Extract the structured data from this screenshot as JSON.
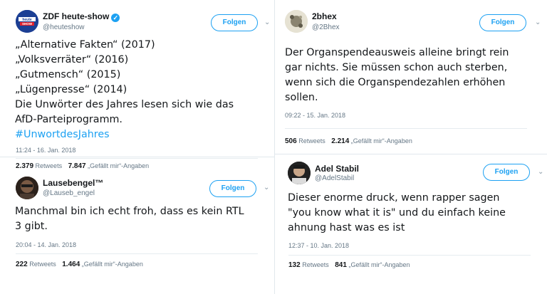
{
  "tweets": [
    {
      "name": "ZDF heute-show",
      "handle": "@heuteshow",
      "verified": true,
      "follow_label": "Folgen",
      "lines": [
        "„Alternative Fakten“ (2017)",
        "„Volksverräter“ (2016)",
        "„Gutmensch“ (2015)",
        "„Lügenpresse“ (2014)",
        "Die Unwörter des Jahres lesen sich wie das",
        "AfD-Parteiprogramm."
      ],
      "hashtag": "#UnwortdesJahres",
      "time": "11:24 - 16. Jan. 2018",
      "retweets": "2.379",
      "retweets_label": "Retweets",
      "likes": "7.847",
      "likes_label": "„Gefällt mir“-Angaben",
      "avatar_text": "heute SHOW"
    },
    {
      "name": "2bhex",
      "handle": "@2Bhex",
      "follow_label": "Folgen",
      "lines": [
        "Der Organspendeausweis alleine bringt rein",
        "gar nichts. Sie müssen schon auch sterben,",
        "wenn sich die Organspendezahlen erhöhen",
        "sollen."
      ],
      "time": "09:22 - 15. Jan. 2018",
      "retweets": "506",
      "retweets_label": "Retweets",
      "likes": "2.214",
      "likes_label": "„Gefällt mir“-Angaben"
    },
    {
      "name": "Lausebengel™",
      "handle": "@Lauseb_engel",
      "follow_label": "Folgen",
      "lines": [
        "Manchmal bin ich echt froh, dass es kein RTL",
        "3 gibt."
      ],
      "time": "20:04 - 14. Jan. 2018",
      "retweets": "222",
      "retweets_label": "Retweets",
      "likes": "1.464",
      "likes_label": "„Gefällt mir“-Angaben"
    },
    {
      "name": "Adel Stabil",
      "handle": "@AdelStabil",
      "follow_label": "Folgen",
      "lines": [
        "Dieser enorme druck, wenn rapper sagen",
        "\"you know what it is\" und du einfach keine",
        "ahnung hast was es ist"
      ],
      "time": "12:37 - 10. Jan. 2018",
      "retweets": "132",
      "retweets_label": "Retweets",
      "likes": "841",
      "likes_label": "„Gefällt mir“-Angaben"
    }
  ],
  "colors": {
    "accent": "#1da1f2",
    "text": "#14171a",
    "muted": "#657786",
    "border": "#e1e8ed"
  },
  "icons": {
    "menu": "chevron-down-icon",
    "verified": "verified-badge-icon"
  }
}
